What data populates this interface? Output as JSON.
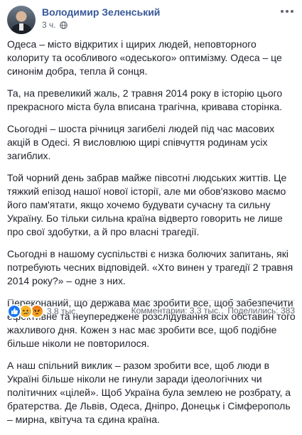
{
  "header": {
    "author": "Володимир Зеленський",
    "time": "3 ч.",
    "privacy_icon": "globe-icon",
    "menu_icon": "more-options-icon"
  },
  "post": {
    "paragraphs": [
      "Одеса – місто відкритих і щирих людей, неповторного колориту та особливого «одеського» оптимізму. Одеса – це синонім добра, тепла й сонця.",
      "Та, на превеликий жаль, 2 травня 2014 року в історію цього прекрасного міста була вписана трагічна, кривава сторінка.",
      "Сьогодні – шоста річниця загибелі людей під час масових акцій в Одесі. Я висловлюю щирі співчуття родинам усіх загиблих.",
      "Той чорний день забрав майже півсотні людських життів. Це тяжкий епізод нашої нової історії, але ми обов'язково маємо його пам'ятати, якщо хочемо будувати сучасну та сильну Україну. Бо тільки сильна країна відверто говорить не лише про свої здобутки, а й про власні трагедії.",
      "Сьогодні в нашому суспільстві є низка болючих запитань, які потребують чесних відповідей. «Хто винен у трагедії 2 травня 2014 року?» – одне з них.",
      "Переконаний, що держава має зробити все, щоб забезпечити ефективне та неупереджене розслідування всіх обставин того жахливого дня. Кожен з нас має зробити все, щоб подібне більше ніколи не повторилося.",
      "А наш спільний виклик – разом зробити все, щоб люди в Україні більше ніколи не гинули заради ідеологічних чи політичних «цілей». Щоб Україна була землею не розбрату, а братерства. Де Львів, Одеса, Дніпро, Донецьк і Сімферополь – мирна, квітуча та єдина країна."
    ]
  },
  "footer": {
    "reactions_count": "3,8 тыс.",
    "comments": "Комментарии: 3,3 тыс.",
    "shares": "Поделились: 383",
    "colors": {
      "like": "#1877f2",
      "link": "#385898",
      "muted": "#606770"
    }
  }
}
